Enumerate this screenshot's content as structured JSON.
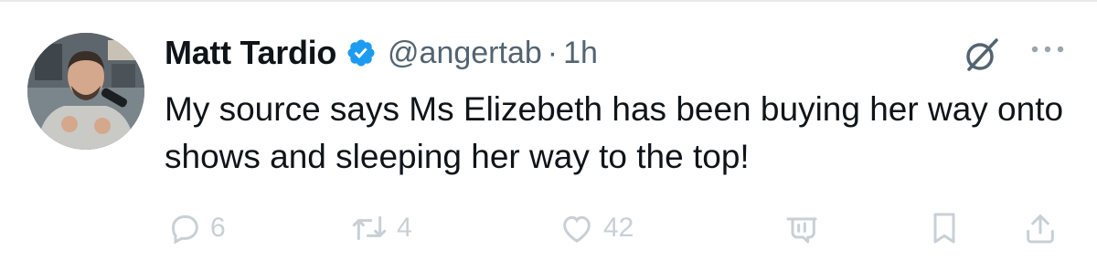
{
  "tweet": {
    "author": {
      "name": "Matt Tardio",
      "verified": true,
      "handle": "@angertab",
      "separator": "·",
      "time": "1h"
    },
    "text": "My source says Ms Elizebeth has been buying her way onto shows and sleeping her way to the top!",
    "actions": {
      "replies": "6",
      "reposts": "4",
      "likes": "42"
    },
    "icons": [
      "grok-icon",
      "more-icon",
      "reply-icon",
      "repost-icon",
      "like-icon",
      "views-icon",
      "bookmark-icon",
      "share-icon"
    ],
    "colors": {
      "verified": "#1d9bf0",
      "secondary_text": "#536471",
      "action_icons": "#c8d0d6"
    }
  }
}
